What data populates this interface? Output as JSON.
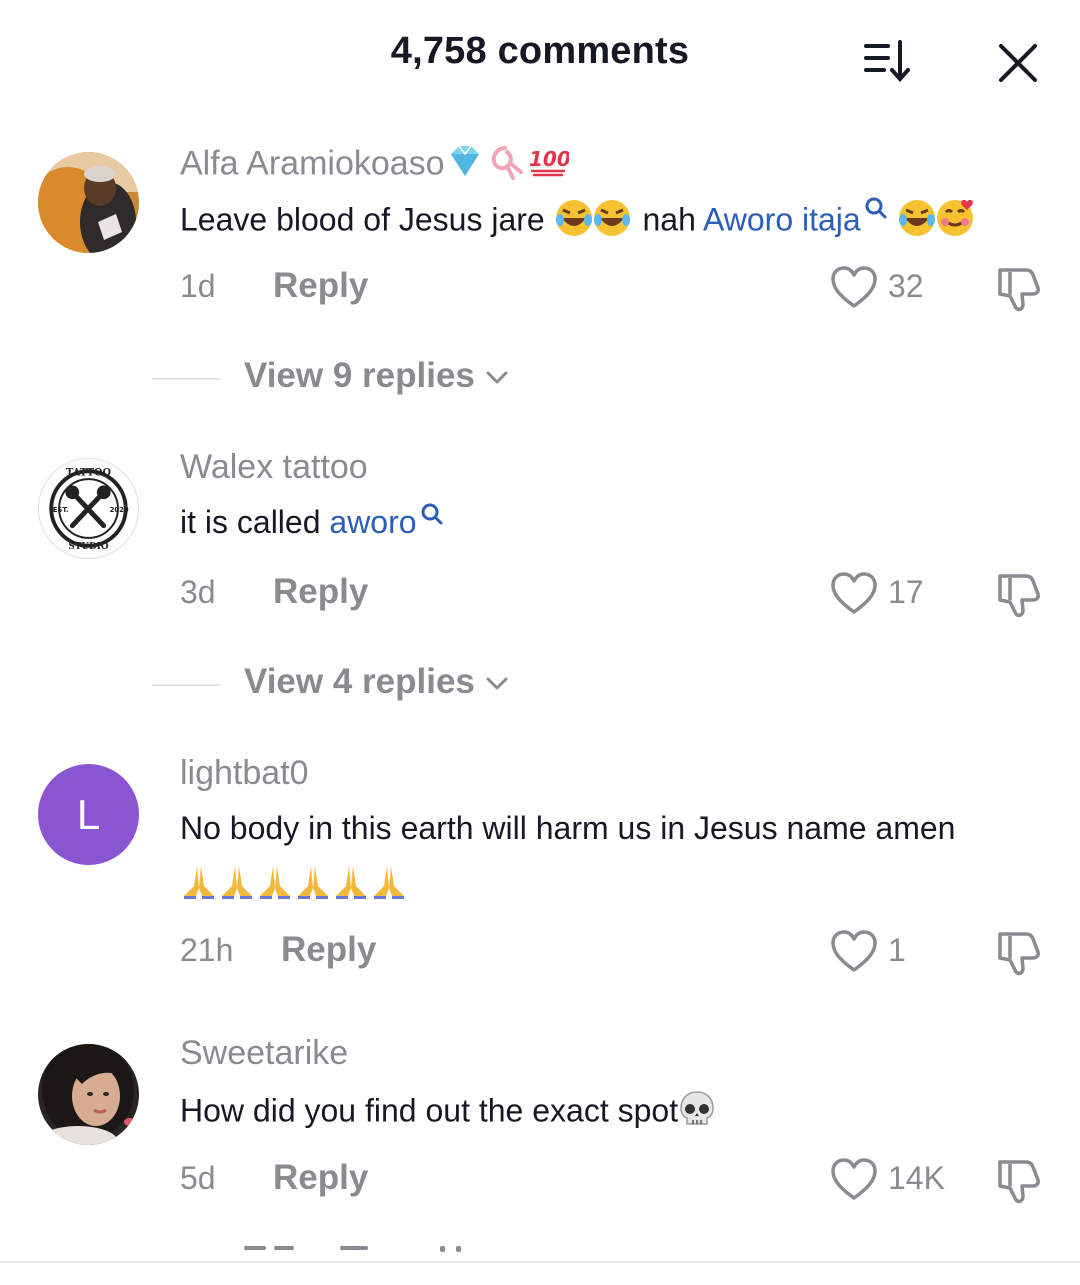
{
  "header": {
    "title": "4,758 comments",
    "sort_icon": "sort-descending-icon",
    "close_icon": "close-icon"
  },
  "colors": {
    "text_primary": "#161823",
    "text_secondary": "#8a8b91",
    "link": "#2b5db9",
    "avatar_purple": "#8a55d1"
  },
  "comments": [
    {
      "username": "Alfa Aramiokoaso",
      "text_before": "Leave blood of Jesus jare ",
      "text_middle": " nah ",
      "link": "Aworo itaja",
      "time": "1d",
      "reply_label": "Reply",
      "likes": "32",
      "view_replies": "View 9 replies"
    },
    {
      "username": "Walex tattoo",
      "text_before": "it is called ",
      "link": "aworo",
      "time": "3d",
      "reply_label": "Reply",
      "likes": "17",
      "view_replies": "View 4 replies",
      "avatar_text": {
        "top": "TATTOO",
        "left": "EST.",
        "right": "2020",
        "bottom": "STUDIO"
      }
    },
    {
      "username": "lightbat0",
      "text_before": "No body in this earth will harm us in Jesus name amen",
      "time": "21h",
      "reply_label": "Reply",
      "likes": "1",
      "avatar_letter": "L"
    },
    {
      "username": "Sweetarike",
      "text_before": "How did you find out the exact spot",
      "time": "5d",
      "reply_label": "Reply",
      "likes": "14K"
    }
  ]
}
